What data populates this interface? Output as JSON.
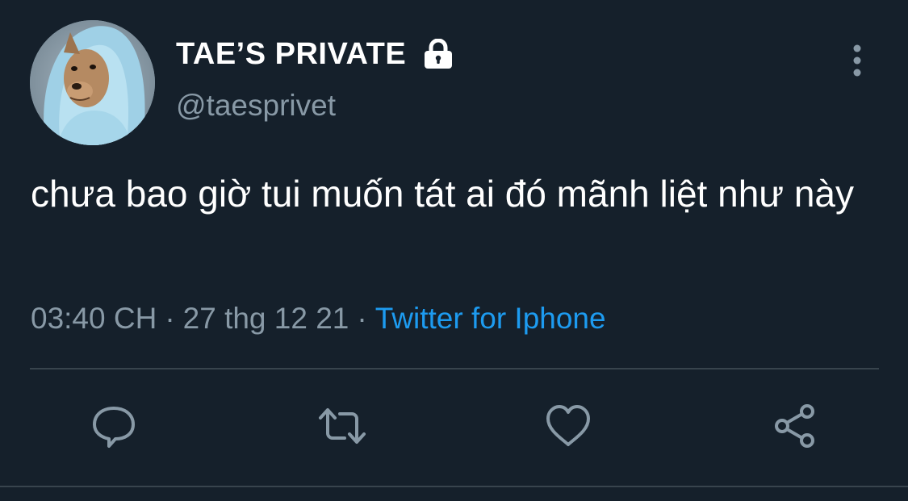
{
  "tweet": {
    "display_name": "TAE’S PRIVATE",
    "handle": "@taesprivet",
    "text": "chưa bao giờ tui muốn tát ai đó mãnh liệt như này",
    "time": "03:40 CH",
    "date": "27 thg 12 21",
    "separator": "·",
    "source": "Twitter for Iphone",
    "protected": true
  },
  "icons": {
    "lock": "lock-icon",
    "more": "more-vertical-icon",
    "reply": "reply-icon",
    "retweet": "retweet-icon",
    "like": "heart-icon",
    "share": "share-icon"
  },
  "colors": {
    "background": "#15202b",
    "text": "#ffffff",
    "secondary_text": "#8899a6",
    "link": "#1d9bf0",
    "divider": "#38444d"
  }
}
